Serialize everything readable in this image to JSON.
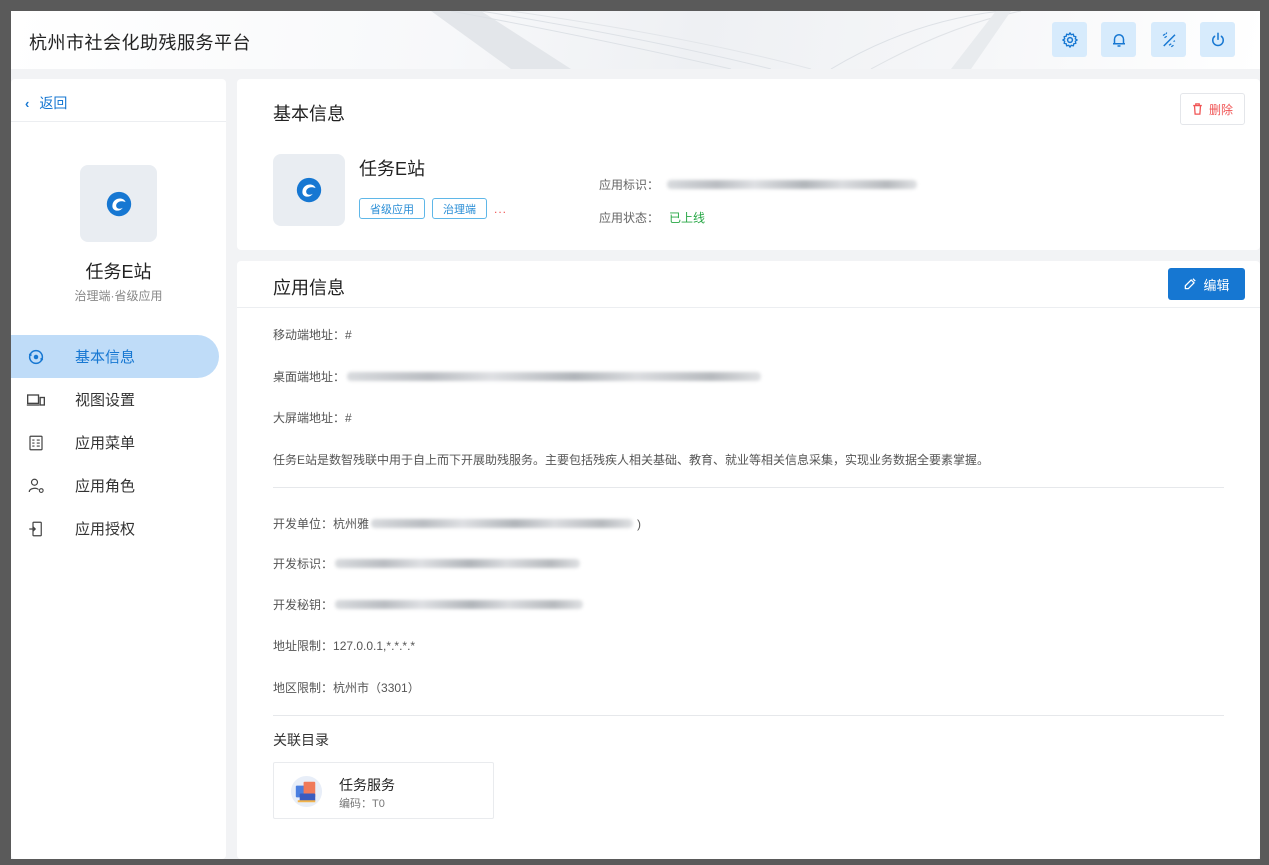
{
  "header": {
    "title": "杭州市社会化助残服务平台",
    "icons": [
      "gear-icon",
      "bell-icon",
      "theme-icon",
      "power-icon"
    ],
    "accent": "#1677d2"
  },
  "sidebar": {
    "back_label": "返回",
    "app_name": "任务E站",
    "app_sub": "治理端·省级应用",
    "items": [
      {
        "label": "基本信息",
        "icon": "info-circle-icon",
        "active": true
      },
      {
        "label": "视图设置",
        "icon": "devices-icon",
        "active": false
      },
      {
        "label": "应用菜单",
        "icon": "menu-list-icon",
        "active": false
      },
      {
        "label": "应用角色",
        "icon": "role-icon",
        "active": false
      },
      {
        "label": "应用授权",
        "icon": "authorize-icon",
        "active": false
      }
    ]
  },
  "basic": {
    "title": "基本信息",
    "delete_label": "删除",
    "app_name": "任务E站",
    "tags": [
      "省级应用",
      "治理端"
    ],
    "more": "...",
    "id_label": "应用标识：",
    "status_label": "应用状态：",
    "status_value": "已上线",
    "status_color": "#27a745"
  },
  "appinfo": {
    "title": "应用信息",
    "edit_label": "编辑",
    "mobile_label": "移动端地址：",
    "mobile_value": "#",
    "desktop_label": "桌面端地址：",
    "screen_label": "大屏端地址：",
    "screen_value": "#",
    "description": "任务E站是数智残联中用于自上而下开展助残服务。主要包括残疾人相关基础、教育、就业等相关信息采集，实现业务数据全要素掌握。",
    "dev_unit_label": "开发单位：",
    "dev_unit_value": "杭州雅",
    "dev_unit_tail": ")",
    "dev_id_label": "开发标识：",
    "dev_secret_label": "开发秘钥：",
    "addr_limit_label": "地址限制：",
    "addr_limit_value": "127.0.0.1,*.*.*.*",
    "region_limit_label": "地区限制：",
    "region_limit_value": "杭州市（3301）",
    "related_label": "关联目录",
    "catalog": {
      "name": "任务服务",
      "code": "编码：T0"
    }
  }
}
